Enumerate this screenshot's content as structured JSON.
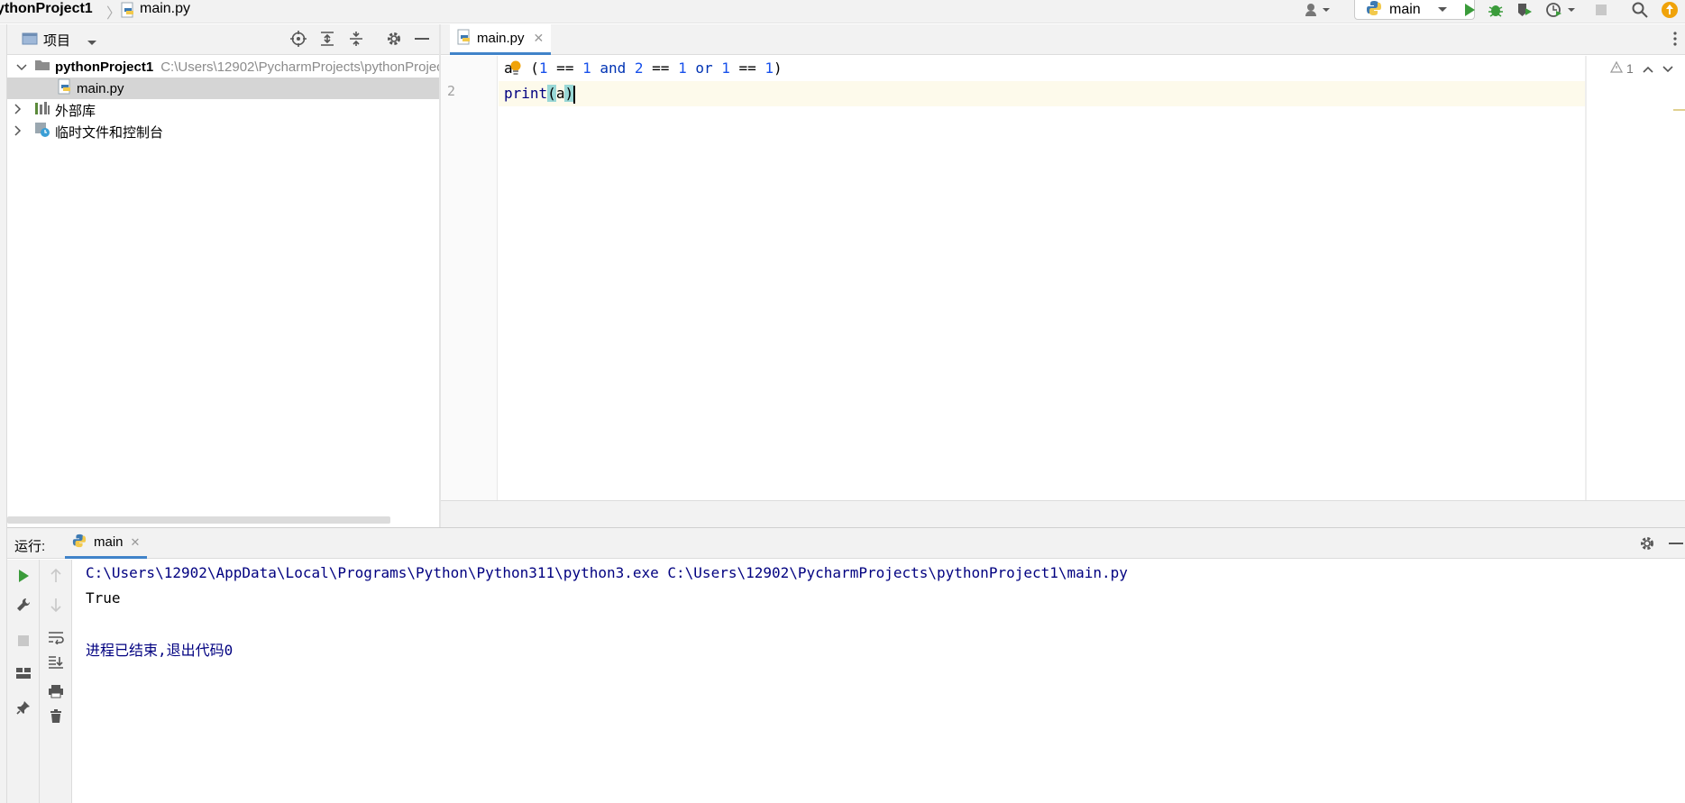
{
  "navbar": {
    "project": "ythonProject1",
    "separator": "〉",
    "file": "main.py"
  },
  "run_config": {
    "label": "main"
  },
  "colors": {
    "accent": "#4083c9",
    "run_green": "#3a9b3a",
    "update_orange": "#f0a30a"
  },
  "project_panel": {
    "title": "项目",
    "tree": {
      "root_name": "pythonProject1",
      "root_path": "C:\\Users\\12902\\PycharmProjects\\pythonProject1",
      "file": "main.py",
      "external_libs": "外部库",
      "scratches": "临时文件和控制台"
    }
  },
  "editor": {
    "tab_label": "main.py",
    "line_2_number": "2",
    "line1": {
      "var": "a",
      "tail": " (",
      "n1": "1",
      "eq1": " == ",
      "n2": "1",
      "and": " and ",
      "n3": "2",
      "eq2": " == ",
      "n4": "1",
      "or": " or ",
      "n5": "1",
      "eq3": " == ",
      "n6": "1",
      "close": ")"
    },
    "line2": {
      "fn": "print",
      "open": "(",
      "arg": "a",
      "close": ")"
    },
    "warning_count": "1"
  },
  "run_panel": {
    "label": "运行:",
    "tab_label": "main",
    "console": {
      "command": "C:\\Users\\12902\\AppData\\Local\\Programs\\Python\\Python311\\python3.exe C:\\Users\\12902\\PycharmProjects\\pythonProject1\\main.py",
      "output": "True",
      "exit": "进程已结束,退出代码0"
    }
  }
}
